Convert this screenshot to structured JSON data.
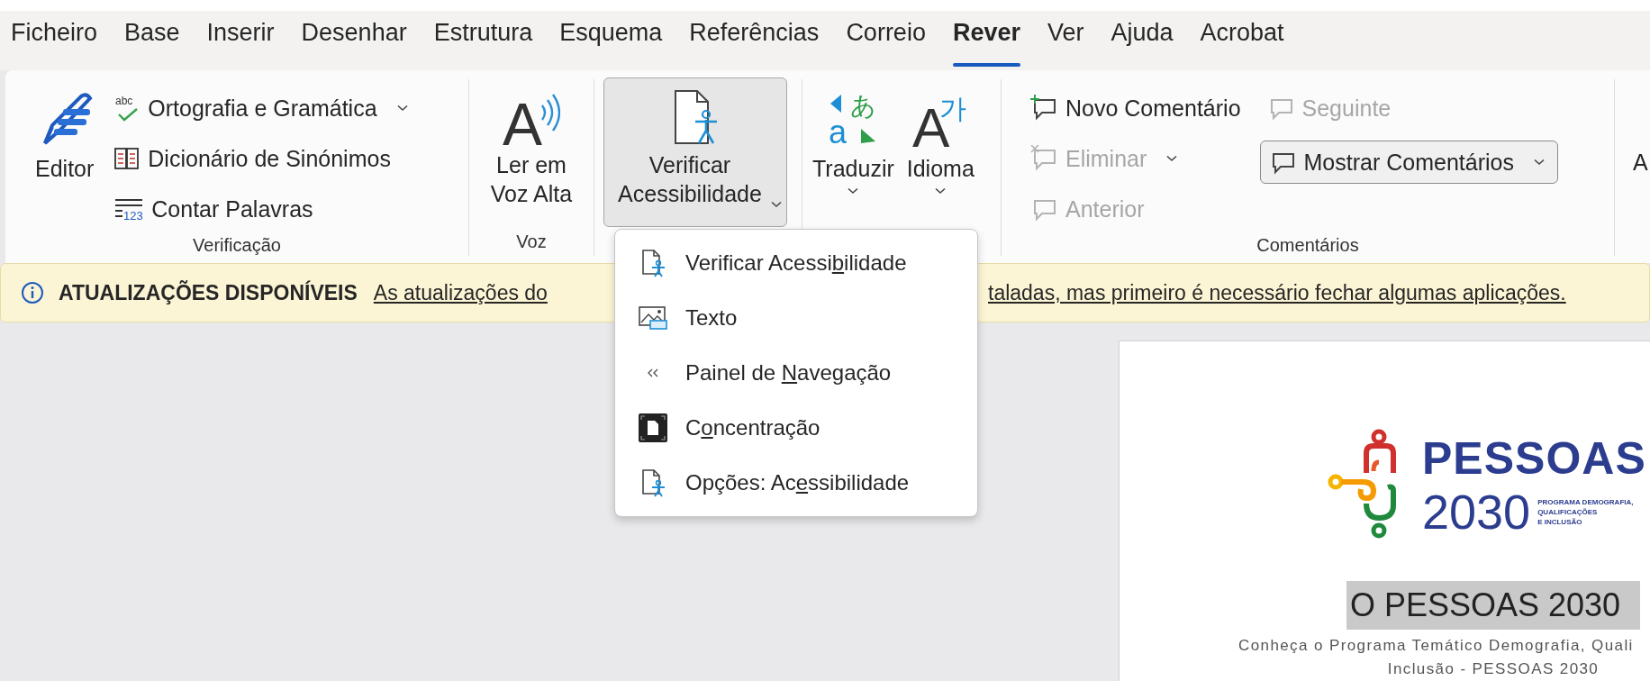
{
  "tabs": [
    {
      "label": "Ficheiro",
      "selected": false
    },
    {
      "label": "Base",
      "selected": false
    },
    {
      "label": "Inserir",
      "selected": false
    },
    {
      "label": "Desenhar",
      "selected": false
    },
    {
      "label": "Estrutura",
      "selected": false
    },
    {
      "label": "Esquema",
      "selected": false
    },
    {
      "label": "Referências",
      "selected": false
    },
    {
      "label": "Correio",
      "selected": false
    },
    {
      "label": "Rever",
      "selected": true
    },
    {
      "label": "Ver",
      "selected": false
    },
    {
      "label": "Ajuda",
      "selected": false
    },
    {
      "label": "Acrobat",
      "selected": false
    }
  ],
  "ribbon": {
    "proofing_group": {
      "label": "Verificação",
      "editor_button": {
        "label": "Editor"
      },
      "spelling_button": {
        "label": "Ortografia e Gramática",
        "icon_glyph": "abc"
      },
      "thesaurus_button": {
        "label": "Dicionário de Sinónimos"
      },
      "word_count_button": {
        "label": "Contar Palavras",
        "icon_glyph": "123"
      }
    },
    "speech_group": {
      "label": "Voz",
      "read_aloud_button": {
        "label_lines": [
          "Ler em",
          "Voz Alta"
        ],
        "icon_glyph": "A"
      }
    },
    "accessibility_group": {
      "check_button": {
        "label_lines": [
          "Verificar",
          "Acessibilidade"
        ],
        "expanded": true
      }
    },
    "language_group": {
      "translate_button": {
        "label": "Traduzir",
        "icon_glyphs": [
          "あ",
          "a"
        ]
      },
      "language_button": {
        "label": "Idioma",
        "icon_glyphs": [
          "A",
          "가"
        ]
      }
    },
    "comments_group": {
      "label": "Comentários",
      "new_comment_button": {
        "label": "Novo Comentário",
        "disabled": false
      },
      "delete_button": {
        "label": "Eliminar",
        "disabled": true
      },
      "previous_button": {
        "label": "Anterior",
        "disabled": true
      },
      "next_button": {
        "label": "Seguinte",
        "disabled": true
      },
      "show_comments_button": {
        "label": "Mostrar Comentários",
        "selected": true
      }
    },
    "cut_off_group": {
      "label": "A"
    }
  },
  "info_bar": {
    "title": "ATUALIZAÇÕES DISPONÍVEIS",
    "message_parts": [
      "As atualizações do",
      "taladas, mas primeiro é necessário fechar algumas aplicações."
    ]
  },
  "dropdown_menu": {
    "items": [
      {
        "text_before": "Verificar Acessi",
        "mnemonic": "b",
        "text_after": "ilidade"
      },
      {
        "text_before": "Texto"
      },
      {
        "text_before": "Painel de ",
        "mnemonic": "N",
        "text_after": "avegação"
      },
      {
        "text_before": "C",
        "mnemonic": "o",
        "text_after": "ncentração"
      },
      {
        "text_before": "Opções: Ac",
        "mnemonic": "e",
        "text_after": "ssibilidade"
      }
    ]
  },
  "document": {
    "logo": {
      "name": "PESSOAS",
      "year": "2030",
      "tagline_lines": [
        "PROGRAMA DEMOGRAFIA,",
        "QUALIFICAÇÕES",
        "E INCLUSÃO"
      ]
    },
    "heading": {
      "text": "O PESSOAS 2030",
      "selected": true
    },
    "subtitle_lines": [
      "Conheça o Programa Temático Demografia, Quali",
      "Inclusão - PESSOAS 2030"
    ]
  }
}
